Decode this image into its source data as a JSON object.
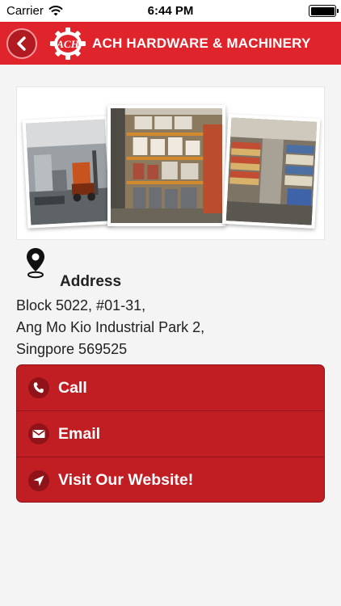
{
  "status_bar": {
    "carrier": "Carrier",
    "time": "6:44 PM",
    "battery_level": 1.0
  },
  "header": {
    "title": "ACH HARDWARE & MACHINERY",
    "logo_text": "ACH"
  },
  "colors": {
    "brand_red": "#e0242c",
    "button_red": "#c11e24"
  },
  "address": {
    "heading": "Address",
    "lines": [
      "Block 5022, #01-31,",
      "Ang Mo Kio Industrial Park 2,",
      "Singpore 569525"
    ]
  },
  "actions": [
    {
      "label": "Call",
      "icon": "phone-icon"
    },
    {
      "label": "Email",
      "icon": "envelope-icon"
    },
    {
      "label": "Visit Our Website!",
      "icon": "navigation-arrow-icon"
    }
  ]
}
